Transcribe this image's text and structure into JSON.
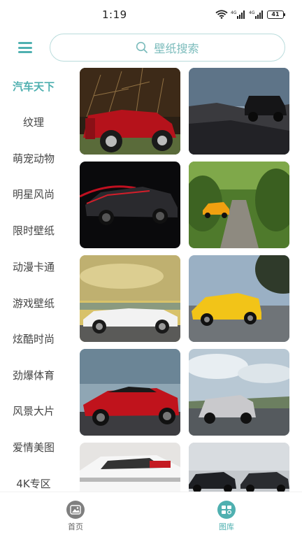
{
  "status_bar": {
    "time": "1:19",
    "battery": "41",
    "network_1": "4G",
    "network_2": "4G"
  },
  "search": {
    "placeholder": "壁纸搜索"
  },
  "colors": {
    "accent": "#4fb0b0",
    "search_border": "#b9dcdc",
    "text": "#444444"
  },
  "sidebar": {
    "items": [
      {
        "label": "汽车天下",
        "active": true
      },
      {
        "label": "纹理",
        "active": false
      },
      {
        "label": "萌宠动物",
        "active": false
      },
      {
        "label": "明星风尚",
        "active": false
      },
      {
        "label": "限时壁纸",
        "active": false
      },
      {
        "label": "动漫卡通",
        "active": false
      },
      {
        "label": "游戏壁纸",
        "active": false
      },
      {
        "label": "炫酷时尚",
        "active": false
      },
      {
        "label": "劲爆体育",
        "active": false
      },
      {
        "label": "风景大片",
        "active": false
      },
      {
        "label": "爱情美图",
        "active": false
      },
      {
        "label": "4K专区",
        "active": false
      }
    ]
  },
  "bottom_nav": {
    "items": [
      {
        "label": "首页",
        "icon": "image-icon",
        "active": false
      },
      {
        "label": "图库",
        "icon": "gallery-icon",
        "active": true
      }
    ]
  }
}
